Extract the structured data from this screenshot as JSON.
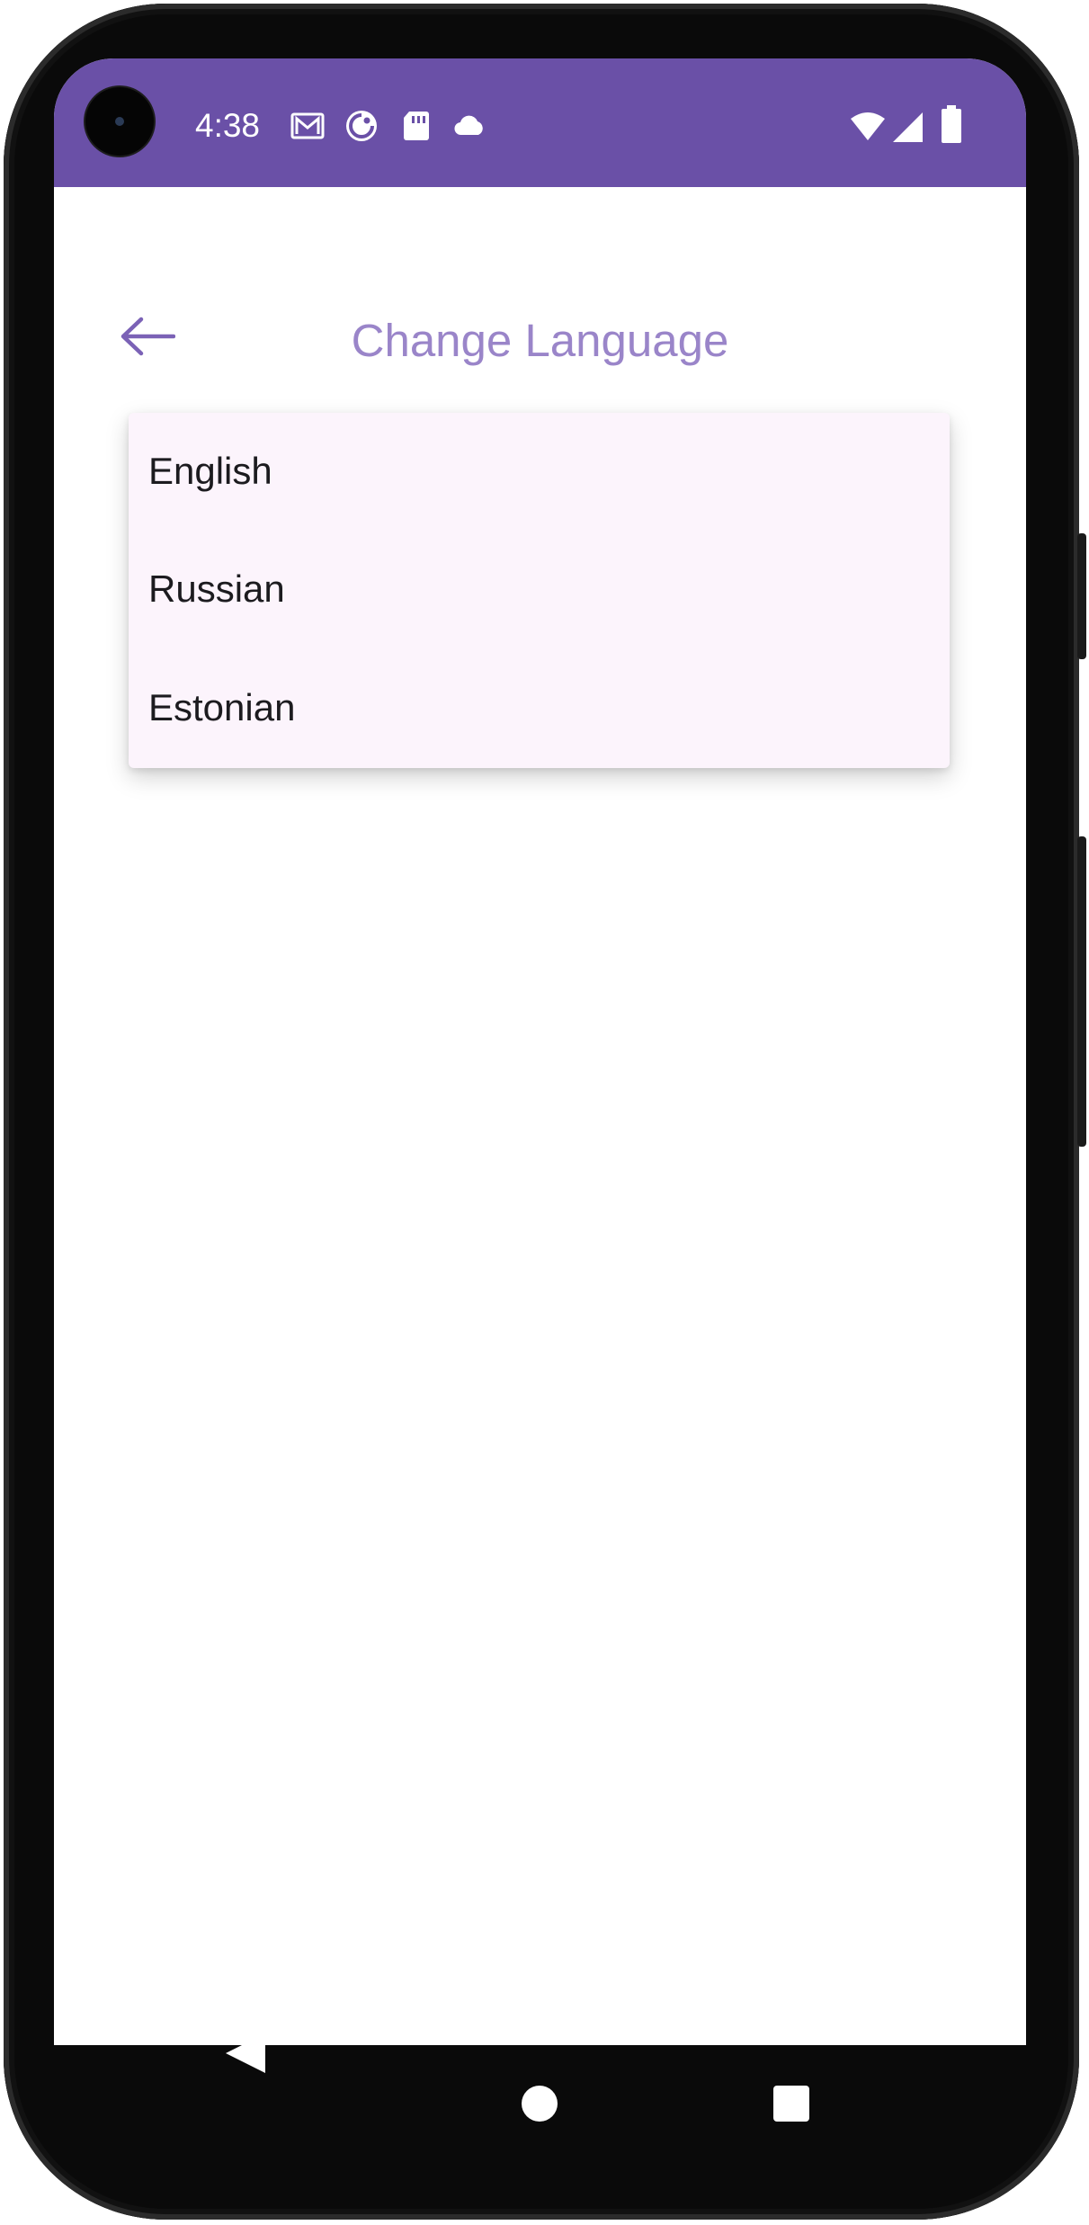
{
  "status_bar": {
    "time": "4:38",
    "background": "#6a50a7",
    "notification_icons": [
      "gmail-icon",
      "pocket-casts-icon",
      "sd-card-icon",
      "cloud-icon"
    ],
    "system_icons": [
      "wifi-icon",
      "cellular-signal-icon",
      "battery-icon"
    ]
  },
  "app_bar": {
    "title": "Change Language",
    "title_color": "#9a85c9",
    "back_icon": "arrow-left-icon"
  },
  "language_menu": {
    "background": "#fcf4fc",
    "options": [
      "English",
      "Russian",
      "Estonian"
    ]
  },
  "navigation_bar": {
    "buttons": [
      "back-triangle-icon",
      "home-circle-icon",
      "recents-square-icon"
    ]
  }
}
